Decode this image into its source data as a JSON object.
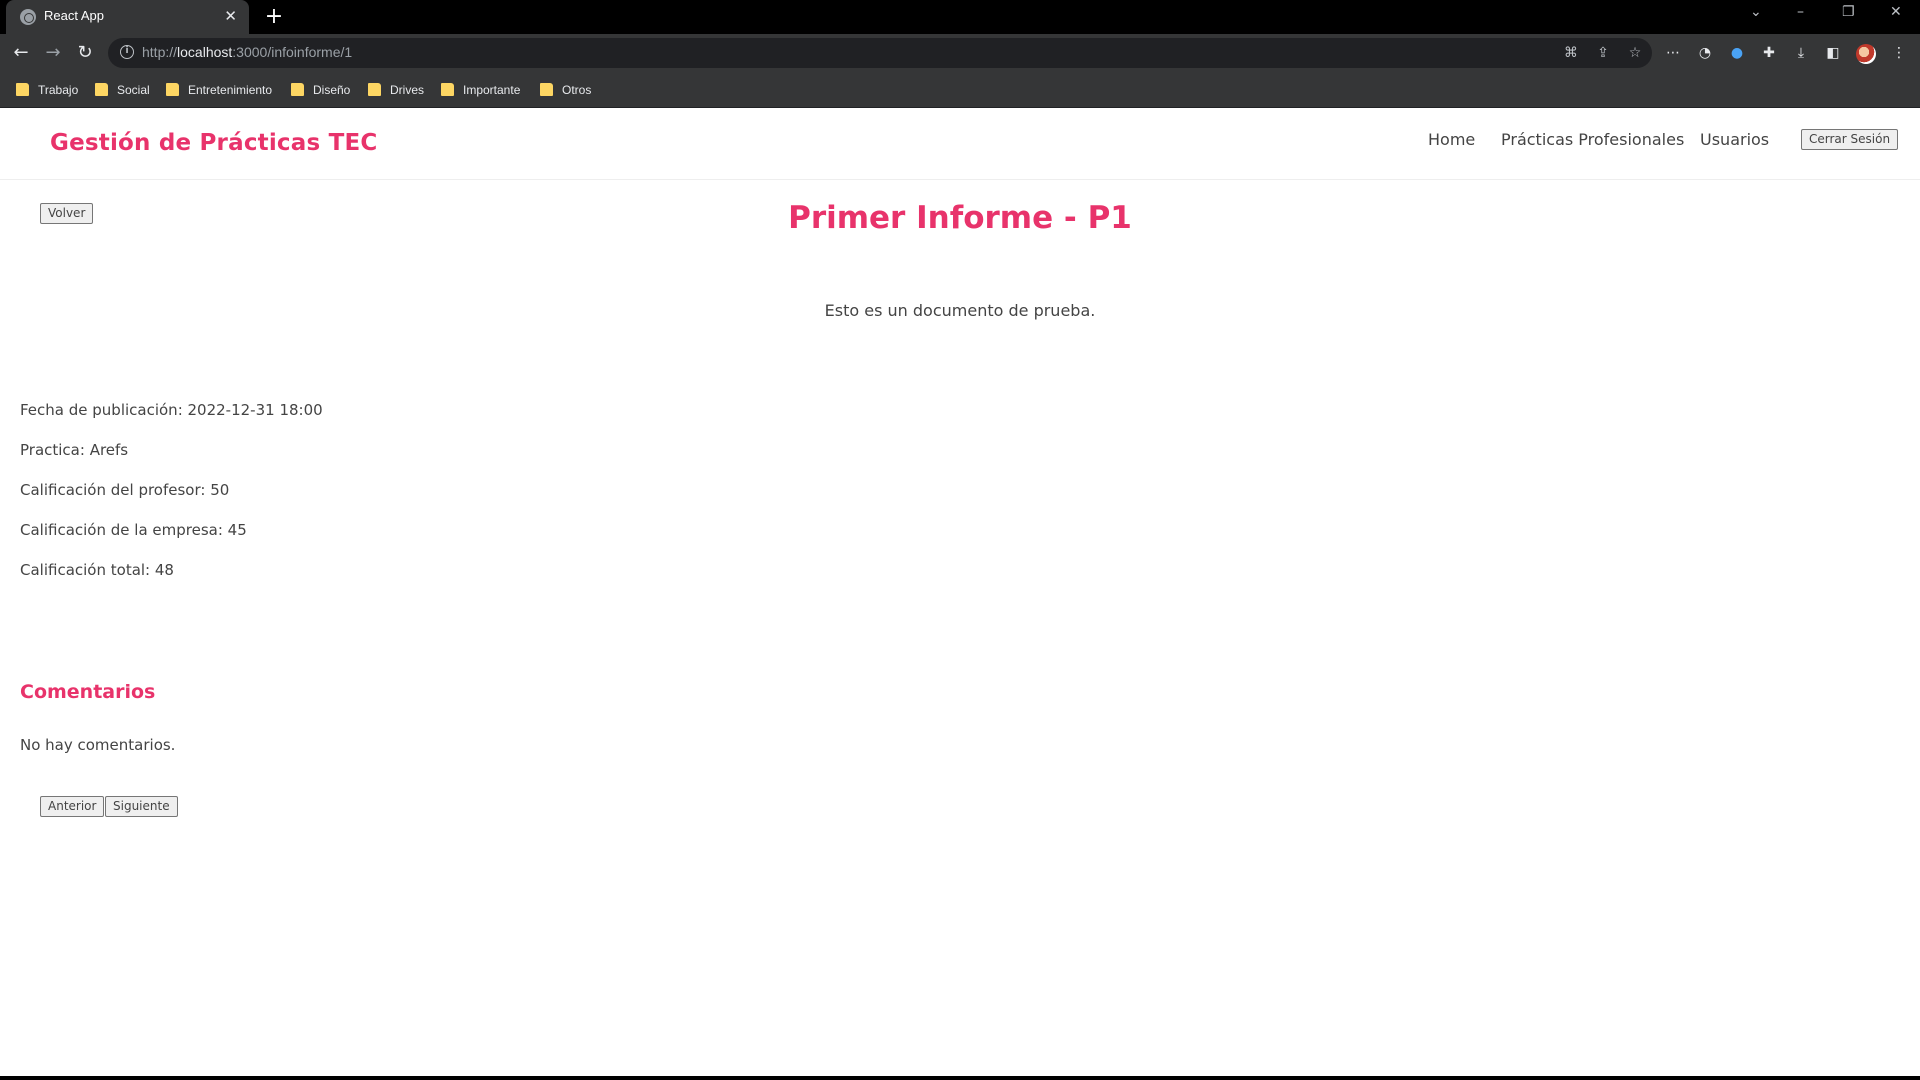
{
  "browser": {
    "tab_title": "React App",
    "url_scheme": "http://",
    "url_host": "localhost",
    "url_path": ":3000/infoinforme/1",
    "bookmarks": [
      "Trabajo",
      "Social",
      "Entretenimiento",
      "Diseño",
      "Drives",
      "Importante",
      "Otros"
    ]
  },
  "header": {
    "brand": "Gestión de Prácticas TEC",
    "nav": [
      "Home",
      "Prácticas Profesionales",
      "Usuarios"
    ],
    "logout_label": "Cerrar Sesión"
  },
  "report": {
    "back_label": "Volver",
    "title": "Primer Informe - P1",
    "body": "Esto es un documento de prueba.",
    "meta": [
      "Fecha de publicación: 2022-12-31 18:00",
      "Practica: Arefs",
      "Calificación del profesor: 50",
      "Calificación de la empresa: 45",
      "Calificación total: 48"
    ]
  },
  "comments": {
    "title": "Comentarios",
    "empty_text": "No hay comentarios.",
    "prev_label": "Anterior",
    "next_label": "Siguiente"
  },
  "colors": {
    "accent": "#e8336b",
    "chrome_bg": "#353637"
  }
}
